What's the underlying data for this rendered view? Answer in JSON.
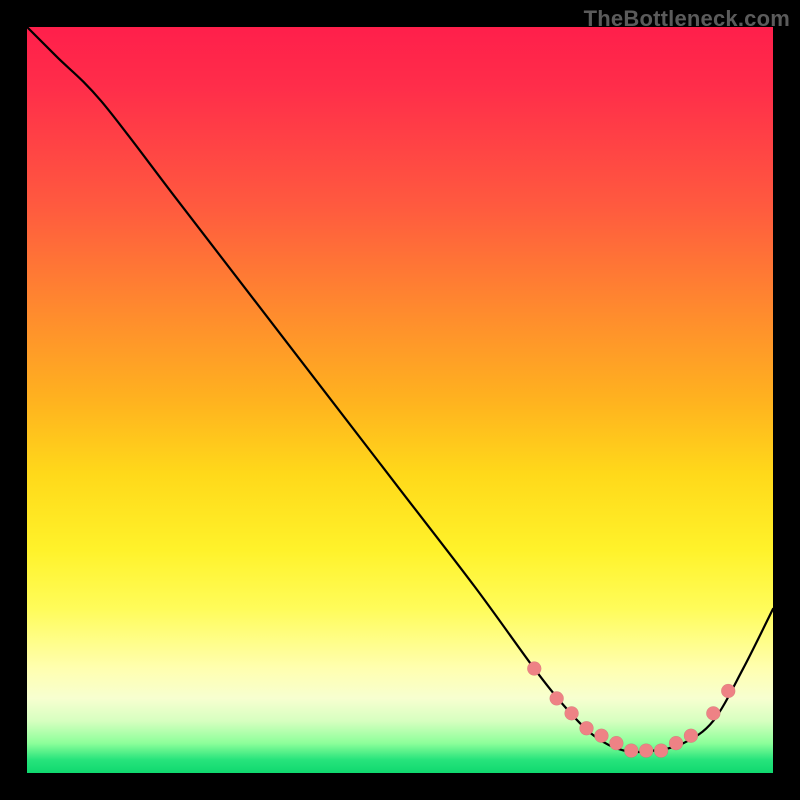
{
  "watermark": "TheBottleneck.com",
  "colors": {
    "background": "#000000",
    "curve": "#000000",
    "marker": "#ee8285",
    "gradient_top": "#ff1f4b",
    "gradient_bottom": "#0fd86f"
  },
  "chart_data": {
    "type": "line",
    "title": "",
    "xlabel": "",
    "ylabel": "",
    "xlim": [
      0,
      100
    ],
    "ylim": [
      0,
      100
    ],
    "grid": false,
    "legend": false,
    "series": [
      {
        "name": "bottleneck-curve",
        "x": [
          0,
          4,
          10,
          20,
          30,
          40,
          50,
          60,
          68,
          72,
          76,
          80,
          84,
          88,
          92,
          96,
          100
        ],
        "y": [
          100,
          96,
          90,
          77,
          64,
          51,
          38,
          25,
          14,
          9,
          5,
          3,
          3,
          4,
          7,
          14,
          22
        ]
      }
    ],
    "markers": {
      "series": "bottleneck-curve",
      "points": [
        {
          "x": 68,
          "y": 14
        },
        {
          "x": 71,
          "y": 10
        },
        {
          "x": 73,
          "y": 8
        },
        {
          "x": 75,
          "y": 6
        },
        {
          "x": 77,
          "y": 5
        },
        {
          "x": 79,
          "y": 4
        },
        {
          "x": 81,
          "y": 3
        },
        {
          "x": 83,
          "y": 3
        },
        {
          "x": 85,
          "y": 3
        },
        {
          "x": 87,
          "y": 4
        },
        {
          "x": 89,
          "y": 5
        },
        {
          "x": 92,
          "y": 8
        },
        {
          "x": 94,
          "y": 11
        }
      ]
    }
  }
}
